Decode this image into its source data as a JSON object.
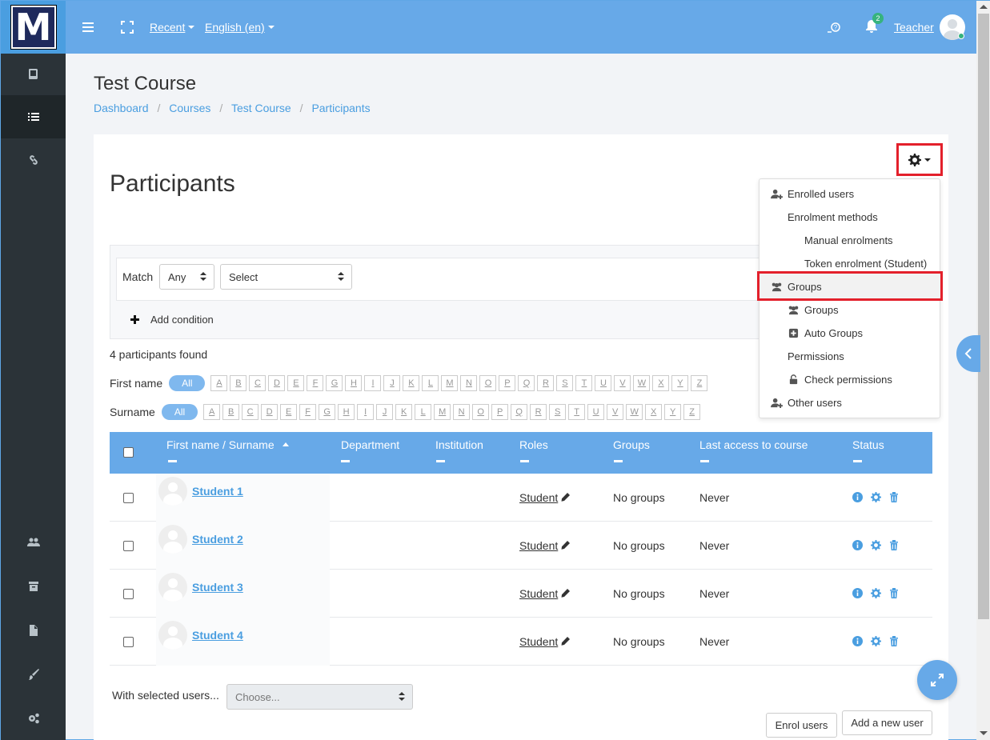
{
  "colors": {
    "accent": "#67a9e8",
    "link": "#4a9ee0",
    "highlight": "#e3202b",
    "rail": "#2b3338"
  },
  "logo": {
    "letter": "M"
  },
  "topbar": {
    "recent": "Recent",
    "language": "English (en)",
    "notifications_count": "2",
    "user_name": "Teacher"
  },
  "header": {
    "course_title": "Test Course",
    "breadcrumb": [
      "Dashboard",
      "Courses",
      "Test Course",
      "Participants"
    ]
  },
  "page_title": "Participants",
  "filter": {
    "match_label": "Match",
    "match_value": "Any",
    "select_value": "Select",
    "add_condition": "Add condition"
  },
  "count_text": "4 participants found",
  "firstname_label": "First name",
  "surname_label": "Surname",
  "all_label": "All",
  "letters": [
    "A",
    "B",
    "C",
    "D",
    "E",
    "F",
    "G",
    "H",
    "I",
    "J",
    "K",
    "L",
    "M",
    "N",
    "O",
    "P",
    "Q",
    "R",
    "S",
    "T",
    "U",
    "V",
    "W",
    "X",
    "Y",
    "Z"
  ],
  "table": {
    "headers": {
      "firstname": "First name",
      "slash": " / ",
      "surname": "Surname",
      "department": "Department",
      "institution": "Institution",
      "roles": "Roles",
      "groups": "Groups",
      "last_access": "Last access to course",
      "status": "Status"
    },
    "rows": [
      {
        "name": "Student 1",
        "role": "Student",
        "groups": "No groups",
        "last_access": "Never"
      },
      {
        "name": "Student 2",
        "role": "Student",
        "groups": "No groups",
        "last_access": "Never"
      },
      {
        "name": "Student 3",
        "role": "Student",
        "groups": "No groups",
        "last_access": "Never"
      },
      {
        "name": "Student 4",
        "role": "Student",
        "groups": "No groups",
        "last_access": "Never"
      }
    ]
  },
  "menu": {
    "enrolled_users": "Enrolled users",
    "enrolment_methods": "Enrolment methods",
    "manual_enrolments": "Manual enrolments",
    "token_enrolment": "Token enrolment (Student)",
    "groups_heading": "Groups",
    "groups": "Groups",
    "auto_groups": "Auto Groups",
    "permissions": "Permissions",
    "check_permissions": "Check permissions",
    "other_users": "Other users"
  },
  "bulk": {
    "with_selected": "With selected users...",
    "choose_placeholder": "Choose..."
  },
  "buttons": {
    "enrol_users": "Enrol users",
    "add_new_user": "Add a new user"
  }
}
